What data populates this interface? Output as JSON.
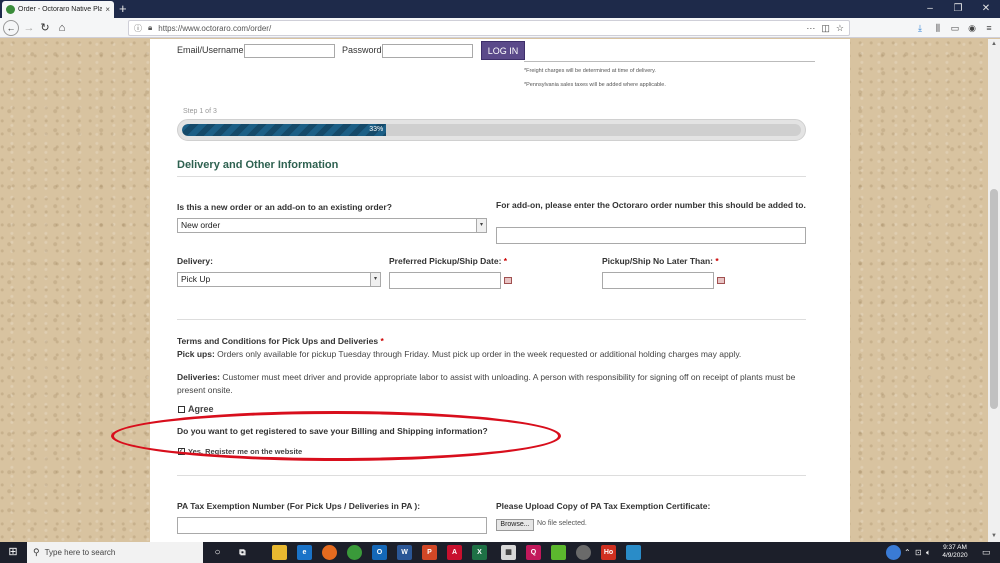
{
  "browser": {
    "tab_title": "Order - Octoraro Native Plant N",
    "tab_close": "×",
    "new_tab": "+",
    "url": "https://www.octoraro.com/order/",
    "minimize": "–",
    "maximize": "❐",
    "close": "✕"
  },
  "login": {
    "email_label": "Email/Username",
    "password_label": "Password",
    "button": "LOG IN"
  },
  "notes": {
    "freight": "*Freight charges will be determined at time of delivery.",
    "tax": "*Pennsylvania sales taxes will be added where applicable."
  },
  "progress": {
    "step": "Step 1 of 3",
    "percent": 33,
    "label": "33%"
  },
  "section": {
    "title": "Delivery and Other Information"
  },
  "order_type": {
    "label": "Is this a new order or an add-on to an existing order?",
    "value": "New order"
  },
  "addon": {
    "label": "For add-on, please enter the Octoraro order number this should be added to."
  },
  "delivery": {
    "label": "Delivery:",
    "value": "Pick Up"
  },
  "pickup_date": {
    "label": "Preferred Pickup/Ship Date:"
  },
  "ship_no_later": {
    "label": "Pickup/Ship No Later Than:"
  },
  "required_mark": "*",
  "terms": {
    "title": "Terms and Conditions for Pick Ups and Deliveries",
    "pickups_label": "Pick ups:",
    "pickups_text": " Orders only available for pickup Tuesday through Friday. Must pick up order in the week requested or additional holding charges may apply.",
    "deliveries_label": "Deliveries:",
    "deliveries_text": " Customer must meet driver and provide appropriate labor to assist with unloading. A person with responsibility for signing off on receipt of plants must be present onsite.",
    "agree": "Agree"
  },
  "register": {
    "question": "Do you want to get registered to save your Billing and Shipping information?",
    "option": "Yes. Register me on the website",
    "checked_mark": "✓"
  },
  "tax_exempt": {
    "label": "PA Tax Exemption Number (For Pick Ups / Deliveries in PA ):",
    "upload_label": "Please Upload Copy of PA Tax Exemption Certificate:",
    "browse": "Browse...",
    "no_file": "No file selected."
  },
  "taskbar": {
    "search_placeholder": "Type here to search",
    "time": "9:37 AM",
    "date": "4/9/2020"
  }
}
